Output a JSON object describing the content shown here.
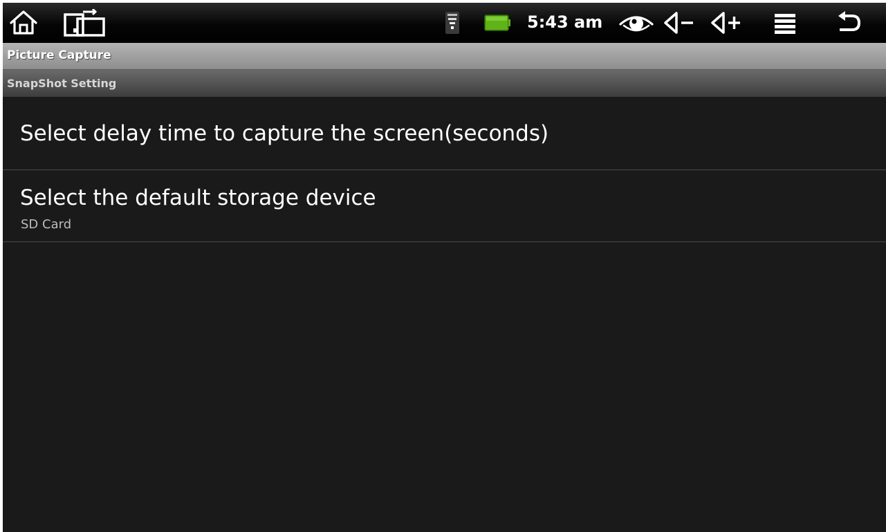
{
  "status_bar": {
    "icons_left": [
      "home-icon",
      "recent-apps-icon"
    ],
    "icons_right": [
      "wifi-icon",
      "battery-icon",
      "eye-icon",
      "volume-down-icon",
      "volume-up-icon",
      "menu-icon",
      "back-icon"
    ],
    "time": "5:43 am",
    "battery_color": "#5fb319"
  },
  "title_bar": {
    "title": "Picture Capture"
  },
  "category": {
    "label": "SnapShot Setting"
  },
  "preferences": [
    {
      "title": "Select delay time to capture the screen(seconds)",
      "summary": ""
    },
    {
      "title": "Select the default storage device",
      "summary": "SD Card"
    }
  ]
}
